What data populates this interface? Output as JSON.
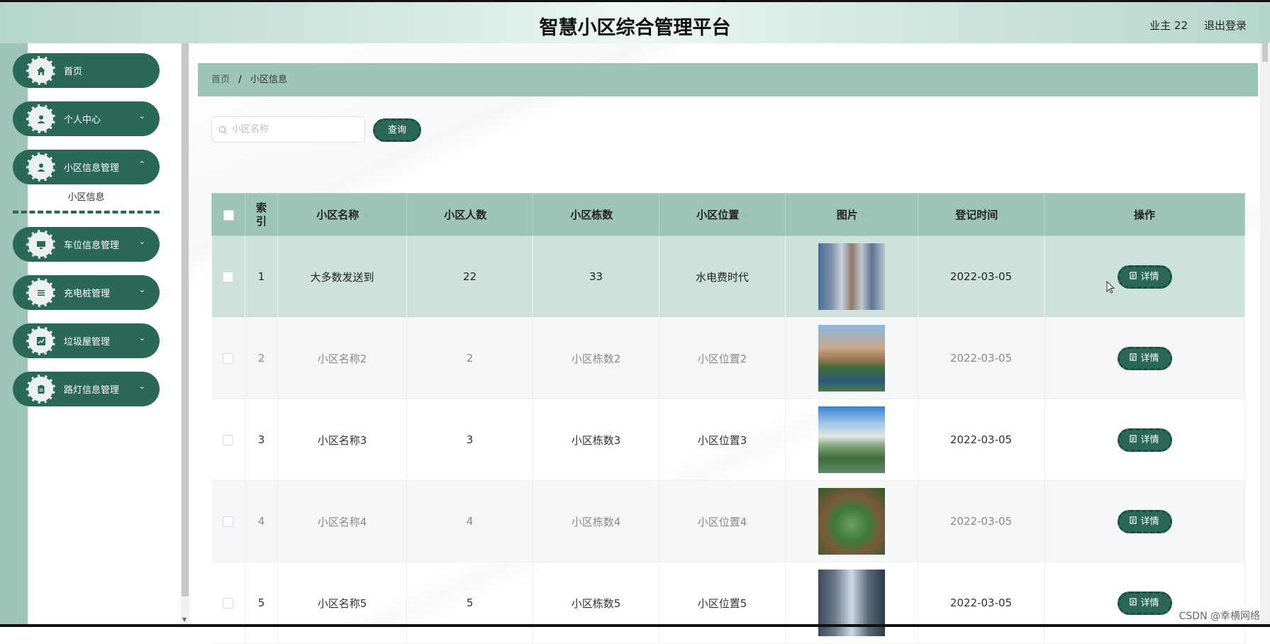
{
  "header": {
    "title": "智慧小区综合管理平台",
    "user": "业主 22",
    "logout": "退出登录"
  },
  "sidebar": {
    "items": [
      {
        "label": "首页",
        "icon": "home-icon"
      },
      {
        "label": "个人中心",
        "icon": "user-icon"
      },
      {
        "label": "小区信息管理",
        "icon": "user-icon"
      },
      {
        "label": "车位信息管理",
        "icon": "monitor-icon"
      },
      {
        "label": "充电桩管理",
        "icon": "list-icon"
      },
      {
        "label": "垃圾屋管理",
        "icon": "chart-icon"
      },
      {
        "label": "路灯信息管理",
        "icon": "clipboard-icon"
      }
    ],
    "submenu": {
      "label": "小区信息"
    }
  },
  "breadcrumb": {
    "home": "首页",
    "separator": "/",
    "current": "小区信息"
  },
  "search": {
    "placeholder": "小区名称",
    "value": "",
    "button": "查询"
  },
  "table": {
    "columns": [
      "索引",
      "小区名称",
      "小区人数",
      "小区栋数",
      "小区位置",
      "图片",
      "登记时间",
      "操作"
    ],
    "rows": [
      {
        "index": "1",
        "name": "大多数发送到",
        "people": "22",
        "buildings": "33",
        "location": "水电费时代",
        "date": "2022-03-05",
        "action": "详情"
      },
      {
        "index": "2",
        "name": "小区名称2",
        "people": "2",
        "buildings": "小区栋数2",
        "location": "小区位置2",
        "date": "2022-03-05",
        "action": "详情"
      },
      {
        "index": "3",
        "name": "小区名称3",
        "people": "3",
        "buildings": "小区栋数3",
        "location": "小区位置3",
        "date": "2022-03-05",
        "action": "详情"
      },
      {
        "index": "4",
        "name": "小区名称4",
        "people": "4",
        "buildings": "小区栋数4",
        "location": "小区位置4",
        "date": "2022-03-05",
        "action": "详情"
      },
      {
        "index": "5",
        "name": "小区名称5",
        "people": "5",
        "buildings": "小区栋数5",
        "location": "小区位置5",
        "date": "2022-03-05",
        "action": "详情"
      }
    ]
  },
  "watermark": "CSDN @幸横网络",
  "colors": {
    "primary": "#2b6857",
    "accent": "#9cc5b7",
    "selected_row": "#cce2db"
  }
}
